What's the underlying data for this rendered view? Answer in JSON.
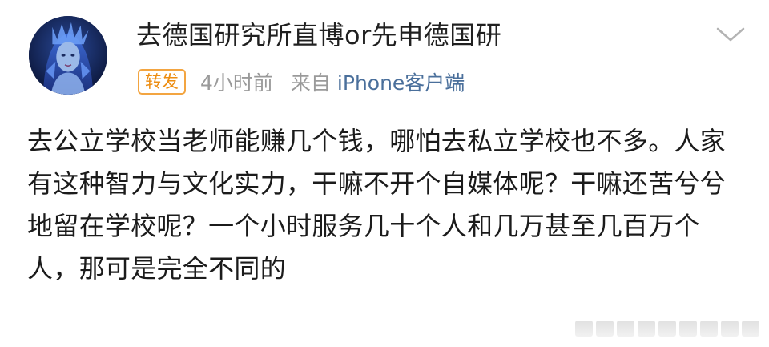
{
  "post": {
    "username": "去德国研究所直博or先申德国研",
    "repost_label": "转发",
    "time": "4小时前",
    "source_prefix": "来自",
    "source_name": "iPhone客户端",
    "content": "去公立学校当老师能赚几个钱，哪怕去私立学校也不多。人家有这种智力与文化实力，干嘛不开个自媒体呢？干嘛还苦兮兮地留在学校呢？一个小时服务几十个人和几万甚至几百万个人，那可是完全不同的"
  },
  "icons": {
    "avatar": "fantasy-character-avatar",
    "more": "chevron-down-icon"
  },
  "colors": {
    "repost_badge": "#ed8d11",
    "source_link": "#4a6f9b",
    "meta_gray": "#9a9a9a"
  }
}
